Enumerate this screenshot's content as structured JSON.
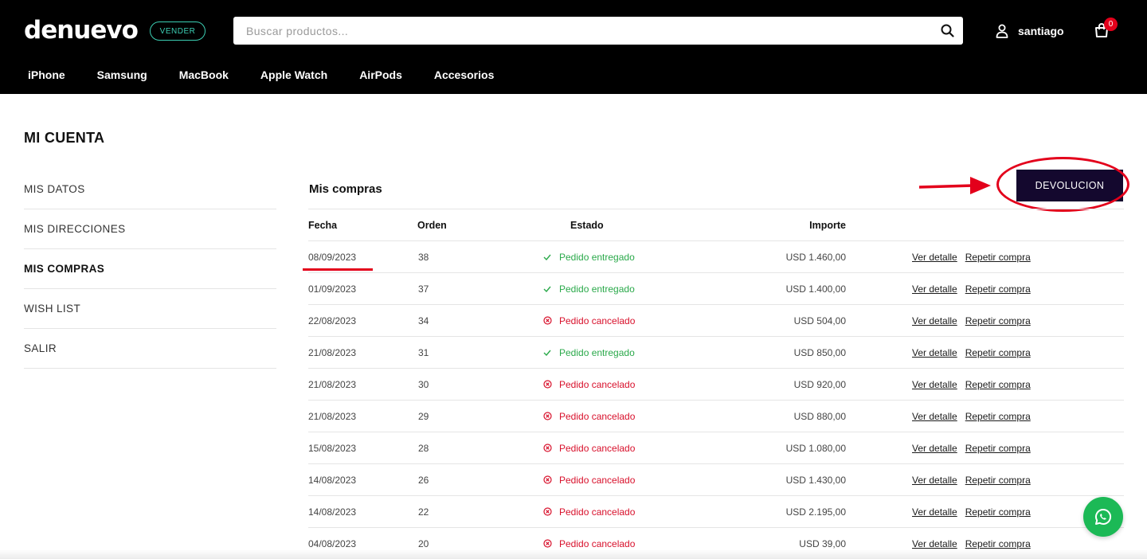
{
  "header": {
    "logo_text": "denuevo",
    "vender_label": "VENDER",
    "search": {
      "placeholder": "Buscar productos...",
      "value": ""
    },
    "user_name": "santiago",
    "cart_count": "0",
    "nav": [
      "iPhone",
      "Samsung",
      "MacBook",
      "Apple Watch",
      "AirPods",
      "Accesorios"
    ]
  },
  "page": {
    "title": "MI CUENTA",
    "sidebar": [
      {
        "label": "MIS DATOS",
        "active": false
      },
      {
        "label": "MIS DIRECCIONES",
        "active": false
      },
      {
        "label": "MIS COMPRAS",
        "active": true
      },
      {
        "label": "WISH LIST",
        "active": false
      },
      {
        "label": "SALIR",
        "active": false
      }
    ],
    "section_title": "Mis compras",
    "devolucion_label": "DEVOLUCION",
    "table": {
      "headers": {
        "fecha": "Fecha",
        "orden": "Orden",
        "estado": "Estado",
        "importe": "Importe"
      },
      "rows": [
        {
          "fecha": "08/09/2023",
          "orden": "38",
          "estado": "Pedido entregado",
          "status": "ok",
          "importe": "USD 1.460,00"
        },
        {
          "fecha": "01/09/2023",
          "orden": "37",
          "estado": "Pedido entregado",
          "status": "ok",
          "importe": "USD 1.400,00"
        },
        {
          "fecha": "22/08/2023",
          "orden": "34",
          "estado": "Pedido cancelado",
          "status": "cancel",
          "importe": "USD 504,00"
        },
        {
          "fecha": "21/08/2023",
          "orden": "31",
          "estado": "Pedido entregado",
          "status": "ok",
          "importe": "USD 850,00"
        },
        {
          "fecha": "21/08/2023",
          "orden": "30",
          "estado": "Pedido cancelado",
          "status": "cancel",
          "importe": "USD 920,00"
        },
        {
          "fecha": "21/08/2023",
          "orden": "29",
          "estado": "Pedido cancelado",
          "status": "cancel",
          "importe": "USD 880,00"
        },
        {
          "fecha": "15/08/2023",
          "orden": "28",
          "estado": "Pedido cancelado",
          "status": "cancel",
          "importe": "USD 1.080,00"
        },
        {
          "fecha": "14/08/2023",
          "orden": "26",
          "estado": "Pedido cancelado",
          "status": "cancel",
          "importe": "USD 1.430,00"
        },
        {
          "fecha": "14/08/2023",
          "orden": "22",
          "estado": "Pedido cancelado",
          "status": "cancel",
          "importe": "USD 2.195,00"
        },
        {
          "fecha": "04/08/2023",
          "orden": "20",
          "estado": "Pedido cancelado",
          "status": "cancel",
          "importe": "USD 39,00"
        }
      ],
      "action_detail": "Ver detalle",
      "action_repeat": "Repetir compra"
    }
  },
  "colors": {
    "header_bg": "#000000",
    "vender_accent": "#3ccfb4",
    "primary_button": "#14082e",
    "status_ok": "#2aa94a",
    "status_cancel": "#d8102b",
    "annotation": "#e3001b",
    "whatsapp": "#1cb956"
  },
  "icons": {
    "search": "search-icon",
    "user": "user-icon",
    "cart": "shopping-bag-icon",
    "status_ok": "check-icon",
    "status_cancel": "x-circle-icon",
    "chat": "whatsapp-icon"
  }
}
